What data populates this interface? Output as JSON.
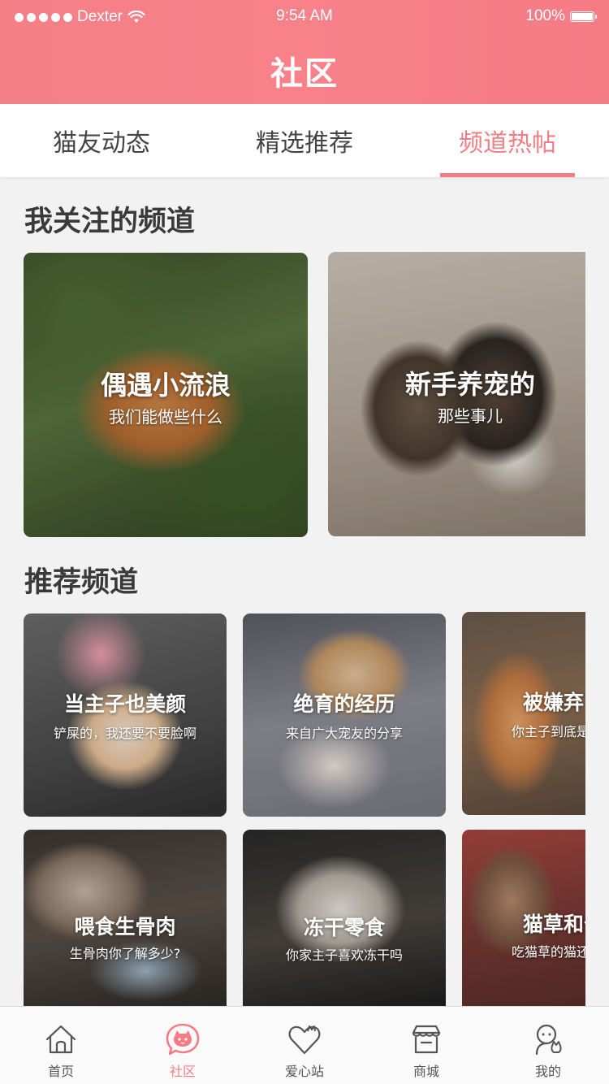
{
  "status_bar": {
    "carrier": "Dexter",
    "time": "9:54 AM",
    "battery": "100%"
  },
  "header": {
    "title": "社区"
  },
  "tabs": [
    {
      "label": "猫友动态",
      "active": false
    },
    {
      "label": "精选推荐",
      "active": false
    },
    {
      "label": "频道热帖",
      "active": true
    }
  ],
  "colors": {
    "accent": "#f37d83",
    "header_bg": "#f8818a"
  },
  "following": {
    "title": "我关注的频道",
    "cards": [
      {
        "title": "偶遇小流浪",
        "subtitle": "我们能做些什么"
      },
      {
        "title": "新手养宠的",
        "subtitle": "那些事儿"
      }
    ]
  },
  "recommended": {
    "title": "推荐频道",
    "cards": [
      {
        "title": "当主子也美颜",
        "subtitle": "铲屎的，我还要不要脸啊"
      },
      {
        "title": "绝育的经历",
        "subtitle": "来自广大宠友的分享"
      },
      {
        "title": "被嫌弃了",
        "subtitle": "你主子到底是有多"
      },
      {
        "title": "喂食生骨肉",
        "subtitle": "生骨肉你了解多少?"
      },
      {
        "title": "冻干零食",
        "subtitle": "你家主子喜欢冻干吗"
      },
      {
        "title": "猫草和化",
        "subtitle": "吃猫草的猫还该不"
      }
    ]
  },
  "bottom_nav": [
    {
      "label": "首页",
      "icon": "home-icon",
      "active": false
    },
    {
      "label": "社区",
      "icon": "community-icon",
      "active": true
    },
    {
      "label": "爱心站",
      "icon": "heart-icon",
      "active": false
    },
    {
      "label": "商城",
      "icon": "shop-icon",
      "active": false
    },
    {
      "label": "我的",
      "icon": "profile-icon",
      "active": false
    }
  ]
}
